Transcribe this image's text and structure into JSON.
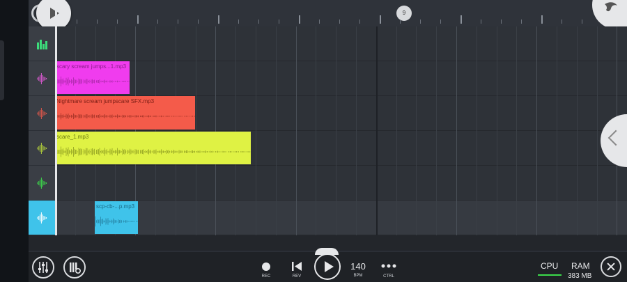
{
  "ruler": {
    "bar_marker": "9"
  },
  "tracks": [
    {
      "icon": "bars-icon",
      "color": "#3cdc7a"
    },
    {
      "icon": "waveform-icon",
      "color": "#e05ad6"
    },
    {
      "icon": "waveform-icon",
      "color": "#e0574a"
    },
    {
      "icon": "waveform-icon",
      "color": "#b5d23a"
    },
    {
      "icon": "waveform-icon",
      "color": "#3cdc4b"
    },
    {
      "icon": "waveform-icon",
      "color": "#ffffff",
      "selected": true
    }
  ],
  "clips": [
    {
      "name": "scary scream jumps...1.mp3",
      "color": "#f03cee",
      "text_color": "#8a1f8a"
    },
    {
      "name": "Nightmare scream jumpscare SFX.mp3",
      "color": "#f45b4a",
      "text_color": "#7a1d14"
    },
    {
      "name": "scare_1.mp3",
      "color": "#dff244",
      "text_color": "#6b7a12"
    },
    {
      "name": "scp-cb-...p.mp3",
      "color": "#3fc3ea",
      "text_color": "#1b6a86"
    }
  ],
  "transport": {
    "rec_label": "REC",
    "rev_label": "REV",
    "bpm_value": "140",
    "bpm_label": "BPM",
    "ctrl_label": "CTRL",
    "cpu_label": "CPU",
    "ram_label": "RAM",
    "ram_value": "383 MB"
  },
  "colors": {
    "accent": "#3fc3ea",
    "cpu_meter": "#3cdc4b"
  }
}
